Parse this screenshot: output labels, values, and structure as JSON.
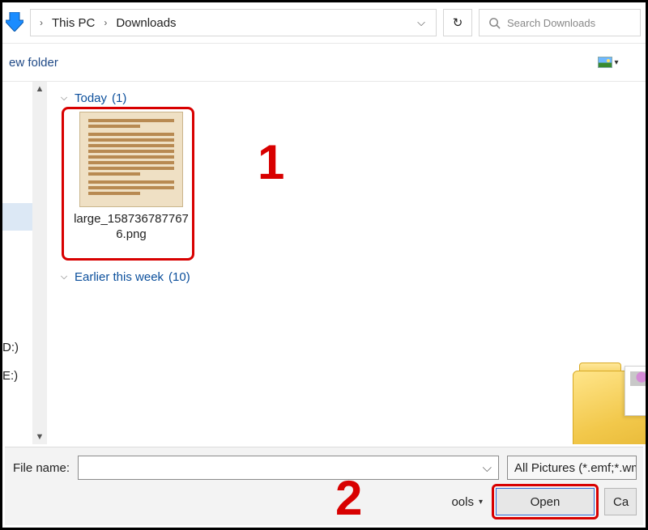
{
  "breadcrumb": {
    "items": [
      "This PC",
      "Downloads"
    ]
  },
  "search": {
    "placeholder": "Search Downloads"
  },
  "toolbar": {
    "new_folder_fragment": "ew folder"
  },
  "tree": {
    "drives": [
      "D:)",
      "E:)"
    ]
  },
  "groups": [
    {
      "name": "Today",
      "count": "(1)",
      "files": [
        {
          "name": "large_1587367877676.png"
        }
      ]
    },
    {
      "name": "Earlier this week",
      "count": "(10)",
      "files": []
    }
  ],
  "footer": {
    "file_name_label": "File name:",
    "file_name_value": "",
    "filter_label": "All Pictures (*.emf;*.wmf;*.",
    "tools_label_fragment": "ools",
    "open_label": "Open",
    "cancel_label_fragment": "Ca"
  },
  "annotations": {
    "one": "1",
    "two": "2"
  }
}
